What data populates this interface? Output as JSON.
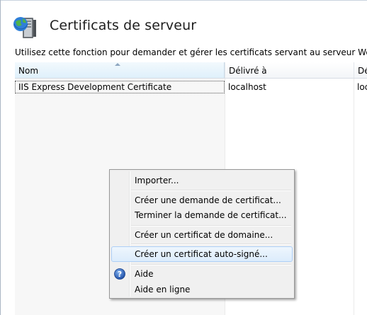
{
  "page": {
    "title": "Certificats de serveur",
    "description": "Utilisez cette fonction pour demander et gérer les certificats servant au serveur Web pour accé"
  },
  "grid": {
    "columns": [
      {
        "label": "Nom",
        "sorted": true
      },
      {
        "label": "Délivré à"
      },
      {
        "label": "Dé"
      }
    ],
    "rows": [
      {
        "name": "IIS Express Development Certificate",
        "issued_to": "localhost",
        "issued_by": "loc"
      }
    ]
  },
  "context_menu": {
    "items": [
      {
        "label": "Importer..."
      },
      {
        "label": "Créer une demande de certificat..."
      },
      {
        "label": "Terminer la demande de certificat..."
      },
      {
        "label": "Créer un certificat de domaine..."
      },
      {
        "label": "Créer un certificat auto-signé...",
        "highlighted": true
      },
      {
        "label": "Aide",
        "icon": "help-icon"
      },
      {
        "label": "Aide en ligne"
      }
    ]
  },
  "icons": {
    "header": "server-certificates-icon",
    "help": "help-icon"
  },
  "colors": {
    "menu_highlight_border": "#aecff7",
    "sorted_column_bg": "#dff0fb"
  }
}
